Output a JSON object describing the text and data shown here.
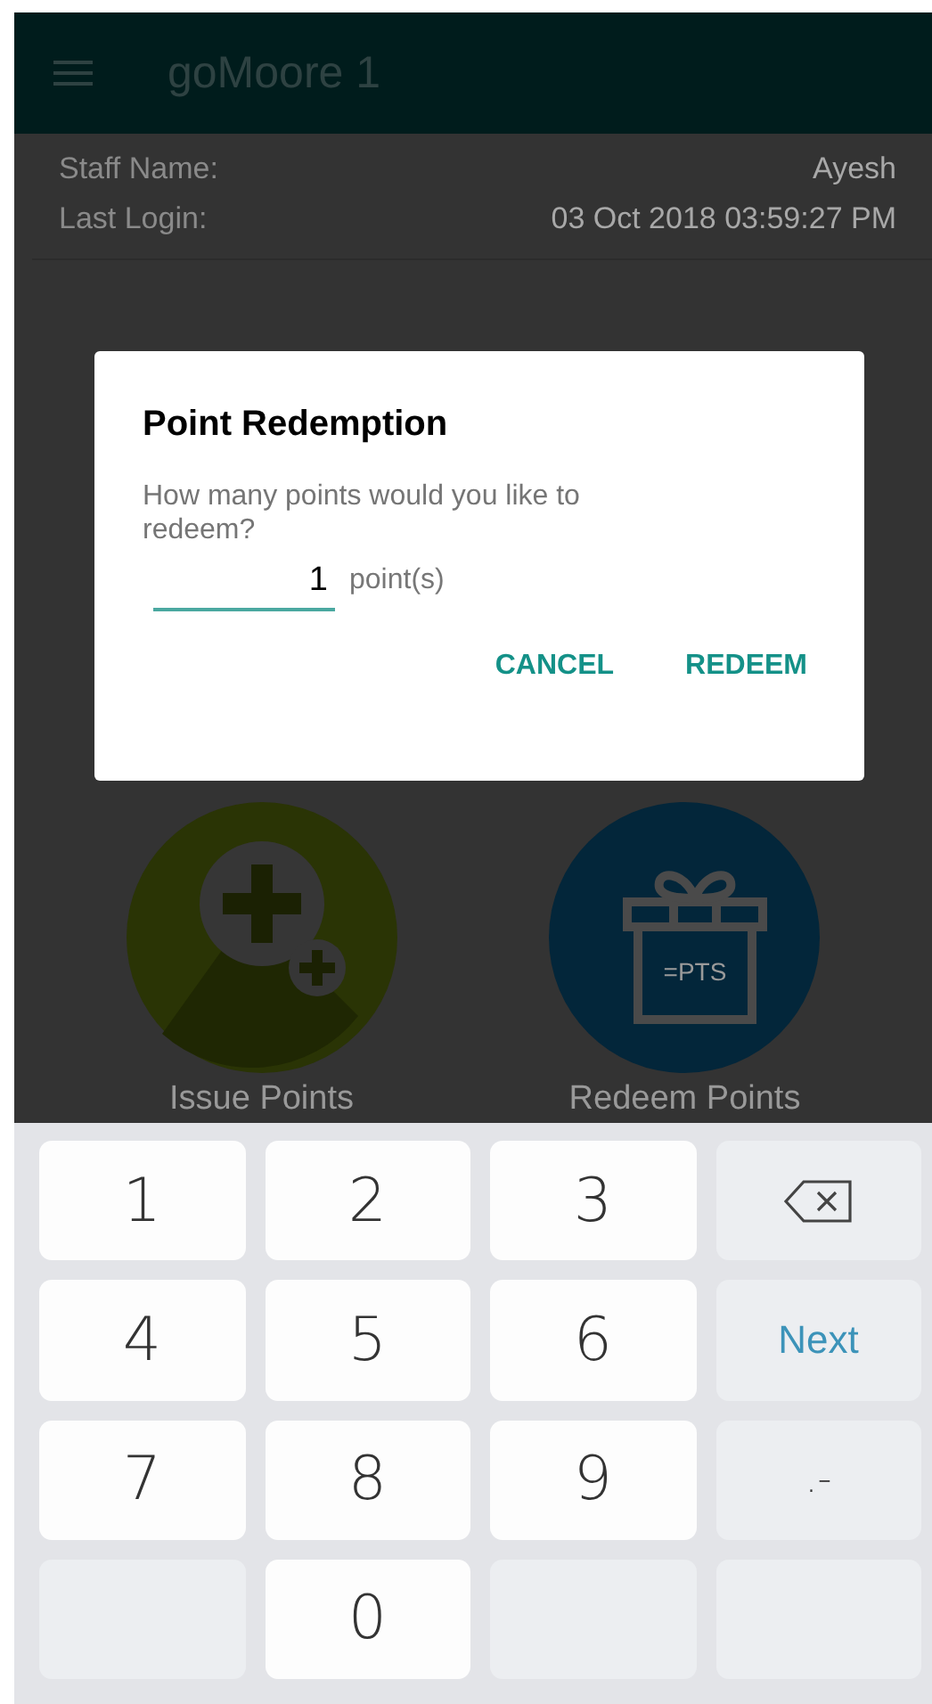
{
  "app_bar": {
    "title": "goMoore 1"
  },
  "staff_info": [
    {
      "label": "Staff Name:",
      "value": "Ayesh"
    },
    {
      "label": "Last Login:",
      "value": "03 Oct 2018 03:59:27 PM"
    }
  ],
  "actions": [
    {
      "kind": "issue",
      "label": "Issue Points"
    },
    {
      "kind": "redeem",
      "label": "Redeem Points",
      "icon_text": "=PTS"
    }
  ],
  "dialog": {
    "title": "Point Redemption",
    "message": "How many points would you like to redeem?",
    "amount": {
      "value": "1"
    },
    "unit": "point(s)",
    "buttons": [
      "CANCEL",
      "REDEEM"
    ]
  },
  "keyboard": [
    {
      "kind": "digit",
      "label": "1"
    },
    {
      "kind": "digit",
      "label": "2"
    },
    {
      "kind": "digit",
      "label": "3"
    },
    {
      "kind": "backspace"
    },
    {
      "kind": "digit",
      "label": "4"
    },
    {
      "kind": "digit",
      "label": "5"
    },
    {
      "kind": "digit",
      "label": "6"
    },
    {
      "kind": "action",
      "label": "Next"
    },
    {
      "kind": "digit",
      "label": "7"
    },
    {
      "kind": "digit",
      "label": "8"
    },
    {
      "kind": "digit",
      "label": "9"
    },
    {
      "kind": "symbol",
      "label": ".-"
    },
    {
      "kind": "blank"
    },
    {
      "kind": "digit",
      "label": "0"
    },
    {
      "kind": "blank"
    },
    {
      "kind": "blank"
    }
  ]
}
